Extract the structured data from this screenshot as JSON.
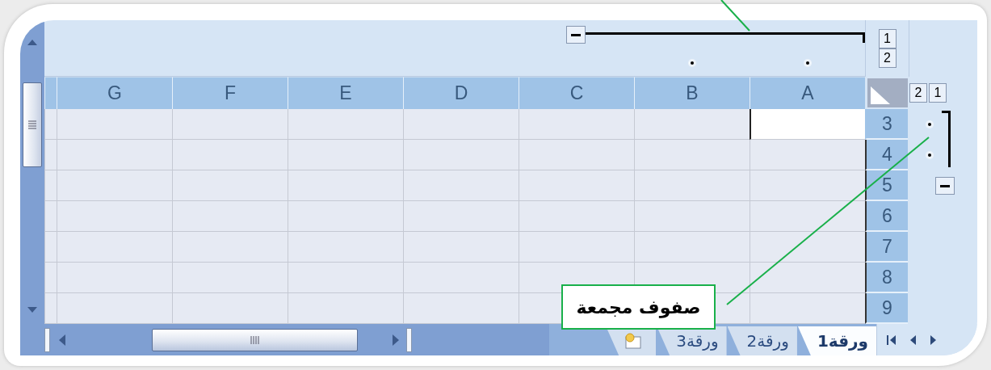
{
  "column_levels": [
    "1",
    "2"
  ],
  "row_levels": [
    "1",
    "2"
  ],
  "columns": [
    {
      "label": "A",
      "grouped": true,
      "selected": true
    },
    {
      "label": "B",
      "grouped": true,
      "selected": false
    },
    {
      "label": "C",
      "grouped": false,
      "selected": false
    },
    {
      "label": "D",
      "grouped": false,
      "selected": false
    },
    {
      "label": "E",
      "grouped": false,
      "selected": false
    },
    {
      "label": "F",
      "grouped": false,
      "selected": false
    },
    {
      "label": "G",
      "grouped": false,
      "selected": false
    }
  ],
  "rows": [
    {
      "number": "3",
      "grouped": true,
      "selected": true
    },
    {
      "number": "4",
      "grouped": true,
      "selected": false
    },
    {
      "number": "5",
      "grouped": false,
      "selected": false
    },
    {
      "number": "6",
      "grouped": false,
      "selected": false
    },
    {
      "number": "7",
      "grouped": false,
      "selected": false
    },
    {
      "number": "8",
      "grouped": false,
      "selected": false
    },
    {
      "number": "9",
      "grouped": false,
      "selected": false
    }
  ],
  "sheet_tabs": [
    {
      "label": "ورقة1",
      "selected": true
    },
    {
      "label": "ورقة2",
      "selected": false
    },
    {
      "label": "ورقة3",
      "selected": false
    }
  ],
  "callouts": [
    {
      "kind": "line"
    },
    {
      "kind": "label",
      "text": "صفوف مجمعة"
    }
  ]
}
